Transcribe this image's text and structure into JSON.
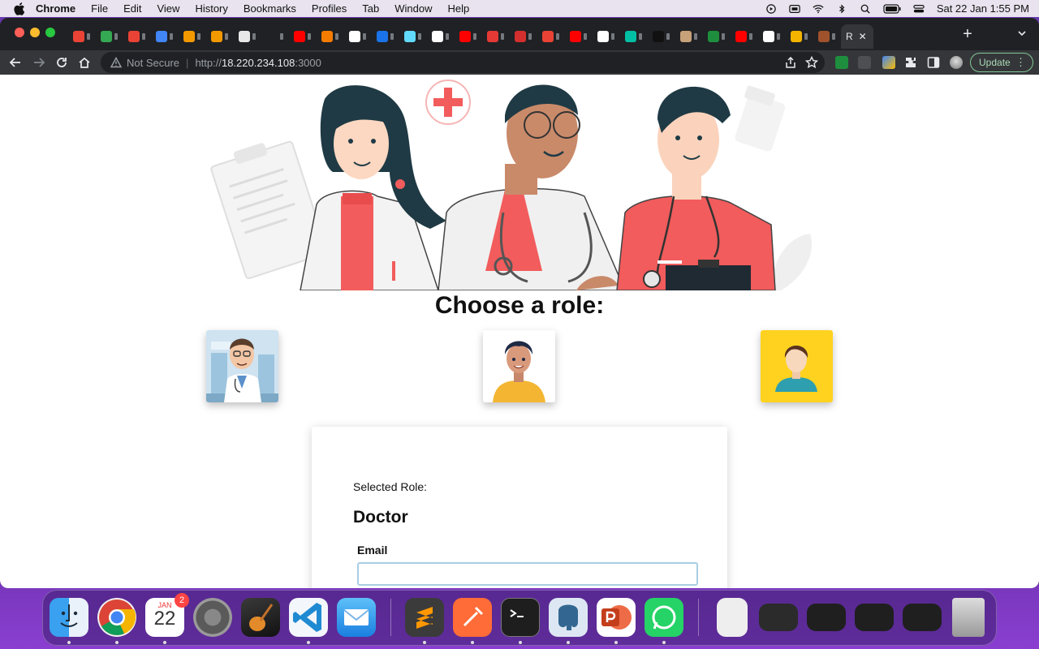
{
  "menubar": {
    "app_name": "Chrome",
    "items": [
      "File",
      "Edit",
      "View",
      "History",
      "Bookmarks",
      "Profiles",
      "Tab",
      "Window",
      "Help"
    ],
    "clock": "Sat 22 Jan  1:55 PM"
  },
  "browser": {
    "active_tab_label": "R",
    "active_tab_close": "✕",
    "new_tab": "+",
    "security_text": "Not Secure",
    "url_prefix": "http://",
    "url_host": "18.220.234.108",
    "url_port": ":3000",
    "update_label": "Update",
    "update_dots": "⋮",
    "tab_favicon_colors": [
      "#ea4335",
      "#34a853",
      "#ea4335",
      "#4285f4",
      "#f29900",
      "#f29900",
      "#e8e8e8",
      "#202124",
      "#ff0000",
      "#f57c00",
      "#ffffff",
      "#1a73e8",
      "#61dafb",
      "#ffffff",
      "#ff0000",
      "#e53935",
      "#d32f2f",
      "#ea4335",
      "#ff0000",
      "#ffffff",
      "#00bfa5",
      "#111111",
      "#c7a17a",
      "#1e8e3e",
      "#ff0000",
      "#ffffff",
      "#f4b400",
      "#a0522d"
    ]
  },
  "page": {
    "heading": "Choose a role:",
    "roles": [
      "Doctor",
      "Patient",
      "User"
    ],
    "selected_role_label": "Selected Role:",
    "selected_role_value": "Doctor",
    "email_label": "Email",
    "email_value": "",
    "email_placeholder": ""
  },
  "dock": {
    "calendar_month": "JAN",
    "calendar_day": "22",
    "calendar_badge": "2",
    "apps": [
      "Finder",
      "Chrome",
      "Calendar",
      "System Preferences",
      "GarageBand",
      "Visual Studio Code",
      "Mail",
      "Sublime Text",
      "Postman",
      "Terminal",
      "pgAdmin",
      "PowerPoint",
      "WhatsApp"
    ]
  },
  "colors": {
    "accent_green": "#81c995",
    "input_border": "#a9cde3",
    "hero_red": "#f25c5c"
  }
}
